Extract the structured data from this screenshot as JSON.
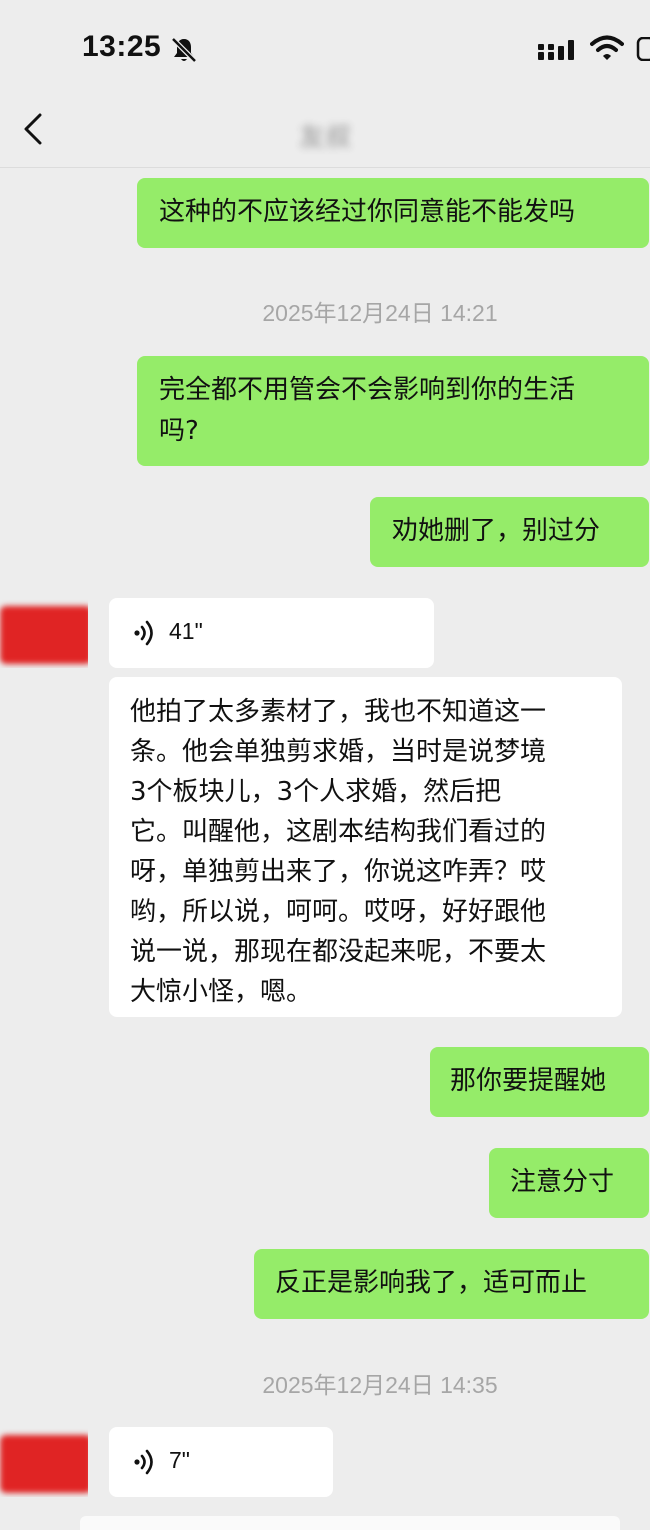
{
  "status_bar": {
    "time": "13:25"
  },
  "nav": {
    "title": "友叔"
  },
  "messages": {
    "m1": "这种的不应该经过你同意能不能发吗",
    "t1": "2025年12月24日 14:21",
    "m2_line1": "完全都不用管会不会影响到你的生活",
    "m2_line2": "吗?",
    "m3": "劝她删了，别过分",
    "v1_duration": "41\"",
    "m4_lines": [
      "他拍了太多素材了，我也不知道这一",
      "条。他会单独剪求婚，当时是说梦境",
      "3个板块儿，3个人求婚，然后把",
      "它。叫醒他，这剧本结构我们看过的",
      "呀，单独剪出来了，你说这咋弄？哎",
      "哟，所以说，呵呵。哎呀，好好跟他",
      "说一说，那现在都没起来呢，不要太",
      "大惊小怪，嗯。"
    ],
    "m5": "那你要提醒她",
    "m6": "注意分寸",
    "m7": "反正是影响我了，适可而止",
    "t2": "2025年12月24日 14:35",
    "v2_duration": "7\""
  },
  "icons": [
    "bell-muted-icon",
    "signal-icon",
    "wifi-icon",
    "battery-icon",
    "back-chevron-icon",
    "voice-wave-icon"
  ],
  "colors": {
    "background": "#ededed",
    "my_bubble": "#95ec69",
    "other_bubble": "#ffffff",
    "timestamp": "#a6a6a6",
    "avatar_redaction": "#e02424"
  }
}
